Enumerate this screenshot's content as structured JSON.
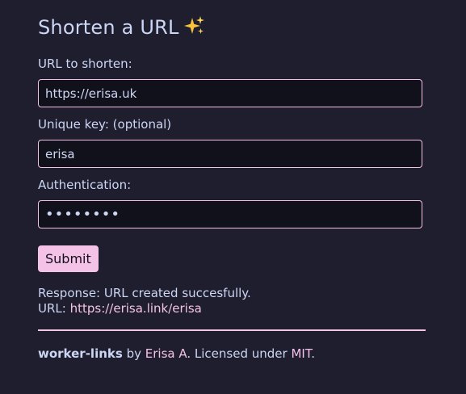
{
  "page": {
    "title": "Shorten a URL",
    "title_icon": "sparkles-icon"
  },
  "form": {
    "url_label": "URL to shorten:",
    "url_value": "https://erisa.uk",
    "key_label": "Unique key: (optional)",
    "key_value": "erisa",
    "auth_label": "Authentication:",
    "auth_value": "••••••••",
    "submit_label": "Submit"
  },
  "response": {
    "prefix": "Response:",
    "message": "URL created succesfully.",
    "url_prefix": "URL:",
    "url": "https://erisa.link/erisa"
  },
  "footer": {
    "project": "worker-links",
    "by_text": "by",
    "author": "Erisa A.",
    "license_text": "Licensed under",
    "license": "MIT",
    "period": "."
  },
  "colors": {
    "background": "#1e1e2e",
    "text": "#cdd6f4",
    "accent": "#f5c2e7",
    "input_bg": "#11111b"
  }
}
